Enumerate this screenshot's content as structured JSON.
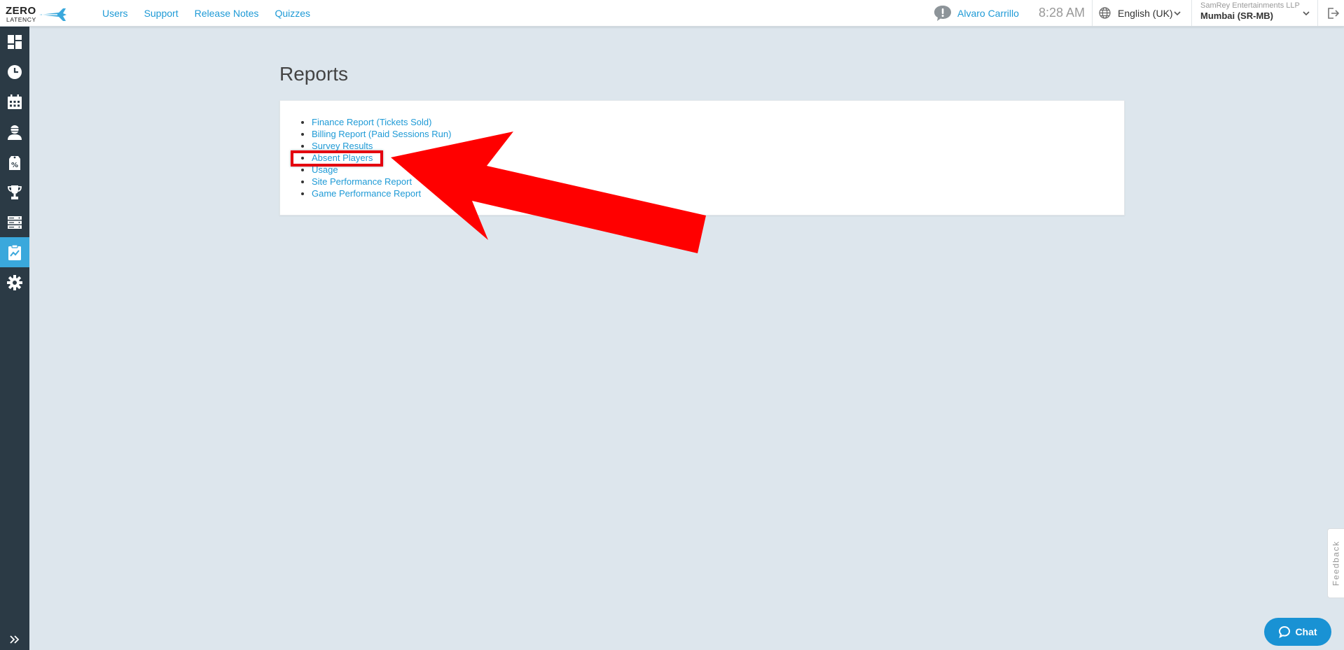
{
  "brand": {
    "line1": "ZERO",
    "line2": "LATENCY"
  },
  "topnav": {
    "items": [
      "Users",
      "Support",
      "Release Notes",
      "Quizzes"
    ]
  },
  "header": {
    "username": "Alvaro Carrillo",
    "time": "8:28 AM",
    "language": "English (UK)",
    "company": "SamRey Entertainments LLP",
    "site": "Mumbai (SR-MB)"
  },
  "sidebar": {
    "items": [
      {
        "icon": "dashboard-icon"
      },
      {
        "icon": "clock-icon"
      },
      {
        "icon": "calendar-icon"
      },
      {
        "icon": "vr-player-icon"
      },
      {
        "icon": "discount-tag-icon"
      },
      {
        "icon": "trophy-icon"
      },
      {
        "icon": "server-icon"
      },
      {
        "icon": "reports-clipboard-icon",
        "active": true
      },
      {
        "icon": "gear-icon"
      }
    ]
  },
  "main": {
    "title": "Reports",
    "reports": [
      "Finance Report (Tickets Sold)",
      "Billing Report (Paid Sessions Run)",
      "Survey Results",
      "Absent Players",
      "Usage",
      "Site Performance Report",
      "Game Performance Report"
    ]
  },
  "feedback": {
    "label": "Feedback"
  },
  "chat": {
    "label": "Chat"
  },
  "colors": {
    "accent": "#1e9ad6",
    "sidebar": "#2b3a45",
    "active": "#3aa8dc",
    "annotation": "#ff0000"
  }
}
